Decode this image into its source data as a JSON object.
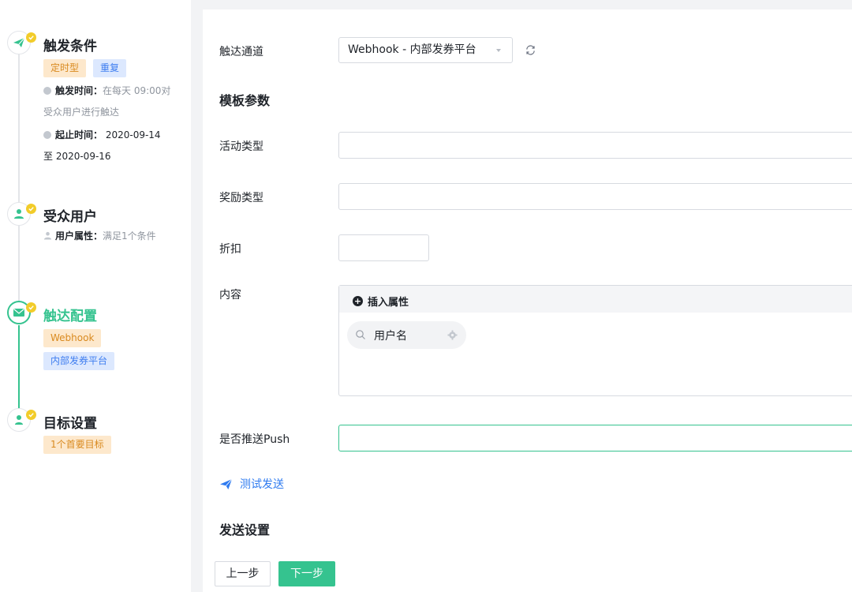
{
  "steps": {
    "trigger": {
      "title": "触发条件",
      "tags": [
        "定时型",
        "重复"
      ],
      "time_key": "触发时间：",
      "time_value_line1": "在每天 09:00对",
      "time_value_line2": "受众用户进行触达",
      "range_key": "起止时间：",
      "range_value_line1": " 2020-09-14",
      "range_value_line2": "至 2020-09-16"
    },
    "audience": {
      "title": "受众用户",
      "attr_key": "用户属性：",
      "attr_value": "满足1个条件"
    },
    "reach": {
      "title": "触达配置",
      "tags": [
        "Webhook",
        "内部发券平台"
      ]
    },
    "goal": {
      "title": "目标设置",
      "tags": [
        "1个首要目标"
      ]
    }
  },
  "form": {
    "channel_label": "触达通道",
    "channel_value": "Webhook - 内部发券平台",
    "template_section": "模板参数",
    "activity_type_label": "活动类型",
    "reward_type_label": "奖励类型",
    "discount_label": "折扣",
    "content_label": "内容",
    "insert_attr": "插入属性",
    "chip_label": "用户名",
    "push_label": "是否推送Push",
    "test_send": "测试发送",
    "send_section": "发送设置"
  },
  "footer": {
    "prev": "上一步",
    "next": "下一步"
  },
  "colors": {
    "accent_green": "#35c38f",
    "link_blue": "#2f7bf0",
    "check_yellow": "#f2cc2a",
    "tag_orange_bg": "#fde8cc",
    "tag_blue_bg": "#dce8fe"
  },
  "icons": {
    "trigger": "paper-plane-icon",
    "audience": "user-icon",
    "reach": "mail-icon",
    "goal": "target-user-icon",
    "done": "check-badge-icon",
    "refresh": "refresh-icon",
    "search": "search-icon",
    "settings": "gear-icon"
  }
}
